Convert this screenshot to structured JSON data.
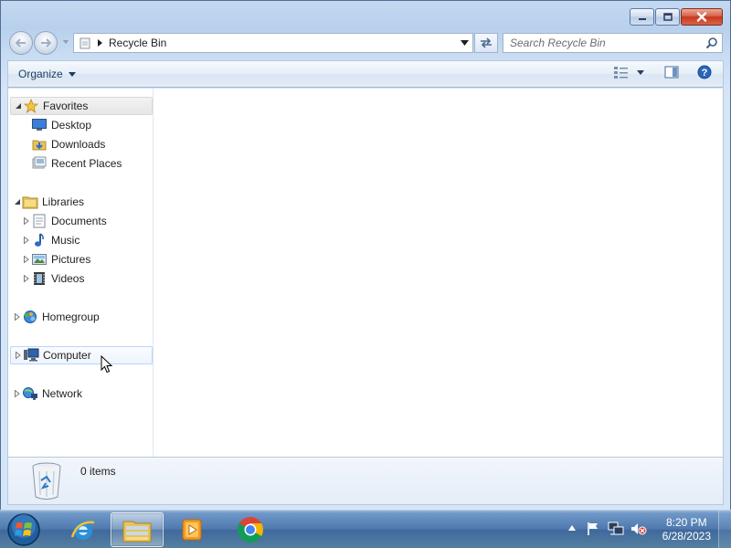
{
  "window": {
    "controls": {
      "minimize_icon": "minimize-icon",
      "maximize_icon": "maximize-icon",
      "close_icon": "close-icon"
    }
  },
  "navigation": {
    "address_location": "Recycle Bin",
    "search_placeholder": "Search Recycle Bin"
  },
  "command_bar": {
    "organize_label": "Organize"
  },
  "nav_pane": {
    "favorites": {
      "label": "Favorites",
      "items": [
        {
          "label": "Desktop",
          "icon": "desktop-icon"
        },
        {
          "label": "Downloads",
          "icon": "downloads-icon"
        },
        {
          "label": "Recent Places",
          "icon": "recent-places-icon"
        }
      ]
    },
    "libraries": {
      "label": "Libraries",
      "items": [
        {
          "label": "Documents",
          "icon": "documents-icon"
        },
        {
          "label": "Music",
          "icon": "music-icon"
        },
        {
          "label": "Pictures",
          "icon": "pictures-icon"
        },
        {
          "label": "Videos",
          "icon": "videos-icon"
        }
      ]
    },
    "homegroup": {
      "label": "Homegroup"
    },
    "computer": {
      "label": "Computer"
    },
    "network": {
      "label": "Network"
    }
  },
  "details_pane": {
    "item_count": "0 items"
  },
  "taskbar": {
    "apps": [
      {
        "name": "Internet Explorer",
        "icon": "internet-explorer-icon"
      },
      {
        "name": "Windows Explorer",
        "icon": "windows-explorer-icon",
        "active": true
      },
      {
        "name": "Windows Media Player",
        "icon": "media-player-icon"
      },
      {
        "name": "Google Chrome",
        "icon": "chrome-icon"
      }
    ],
    "clock": {
      "time": "8:20 PM",
      "date": "6/28/2023"
    }
  },
  "colors": {
    "window_frame": "#b8d0ec",
    "taskbar": "#4f79ad",
    "selection_border": "#b8d6fb"
  }
}
